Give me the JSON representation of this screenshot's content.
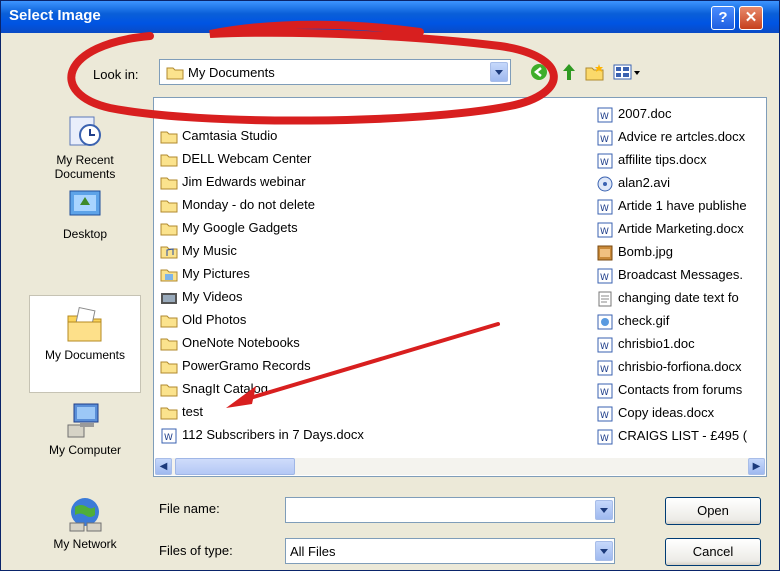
{
  "window": {
    "title": "Select Image"
  },
  "toolbar": {
    "look_in_label": "Look in:",
    "look_in_value": "My Documents"
  },
  "places": [
    {
      "label": "My Recent\nDocuments",
      "icon": "recent-documents-icon"
    },
    {
      "label": "Desktop",
      "icon": "desktop-icon"
    },
    {
      "label": "My Documents",
      "icon": "my-documents-icon",
      "selected": true
    },
    {
      "label": "My Computer",
      "icon": "my-computer-icon"
    },
    {
      "label": "My Network",
      "icon": "my-network-icon"
    }
  ],
  "files_col1": [
    {
      "name": "Camtasia Studio",
      "type": "folder"
    },
    {
      "name": "DELL Webcam Center",
      "type": "folder"
    },
    {
      "name": "Jim Edwards webinar",
      "type": "folder"
    },
    {
      "name": "Monday - do not delete",
      "type": "folder"
    },
    {
      "name": "My Google Gadgets",
      "type": "folder"
    },
    {
      "name": "My Music",
      "type": "music-folder"
    },
    {
      "name": "My Pictures",
      "type": "pictures-folder"
    },
    {
      "name": "My Videos",
      "type": "videos-folder"
    },
    {
      "name": "Old Photos",
      "type": "folder"
    },
    {
      "name": "OneNote Notebooks",
      "type": "folder"
    },
    {
      "name": "PowerGramo Records",
      "type": "folder"
    },
    {
      "name": "SnagIt Catalog",
      "type": "folder"
    },
    {
      "name": "test",
      "type": "folder"
    },
    {
      "name": "112 Subscribers in 7 Days.docx",
      "type": "doc"
    }
  ],
  "files_col2": [
    {
      "name": "2007.doc",
      "type": "doc"
    },
    {
      "name": "Advice re artcles.docx",
      "type": "doc"
    },
    {
      "name": "affilite tips.docx",
      "type": "doc"
    },
    {
      "name": "alan2.avi",
      "type": "video"
    },
    {
      "name": "Artide 1 have publishe",
      "type": "doc"
    },
    {
      "name": "Artide Marketing.docx",
      "type": "doc"
    },
    {
      "name": "Bomb.jpg",
      "type": "image"
    },
    {
      "name": "Broadcast Messages.",
      "type": "doc"
    },
    {
      "name": "changing date text fo",
      "type": "text"
    },
    {
      "name": "check.gif",
      "type": "image"
    },
    {
      "name": "chrisbio1.doc",
      "type": "doc"
    },
    {
      "name": "chrisbio-forfiona.docx",
      "type": "doc"
    },
    {
      "name": "Contacts from forums",
      "type": "doc"
    },
    {
      "name": "Copy ideas.docx",
      "type": "doc"
    },
    {
      "name": "CRAIGS LIST - £495 (",
      "type": "doc"
    }
  ],
  "form": {
    "file_name_label": "File name:",
    "file_name_value": "",
    "file_type_label": "Files of type:",
    "file_type_value": "All Files",
    "open_label": "Open",
    "cancel_label": "Cancel"
  },
  "colors": {
    "title_bar": "#0054e3",
    "dialog_bg": "#ece9d8",
    "annotation_red": "#d81f1f"
  }
}
